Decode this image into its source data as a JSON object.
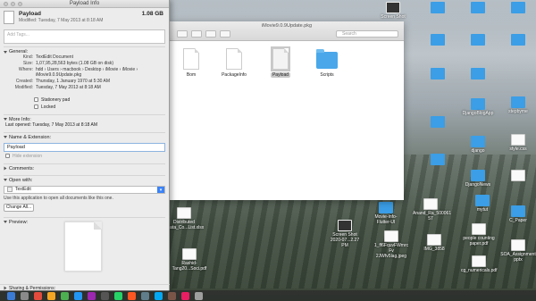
{
  "info_window": {
    "title": "Payload Info",
    "file_name": "Payload",
    "modified_header": "Modified: Tuesday, 7 May 2013 at 8:18 AM",
    "size": "1.08 GB",
    "tags_placeholder": "Add Tags...",
    "general": {
      "header": "General:",
      "rows": [
        {
          "key": "Kind:",
          "value": "TextEdit Document"
        },
        {
          "key": "Size:",
          "value": "1,07,95,28,563 bytes (1.08 GB on disk)"
        },
        {
          "key": "Where:",
          "value": "hdd › Users › macbook › Desktop › iMovie › iMovie › iMovie9.0.9Update.pkg"
        },
        {
          "key": "Created:",
          "value": "Thursday, 1 January 1970 at 5:30 AM"
        },
        {
          "key": "Modified:",
          "value": "Tuesday, 7 May 2013 at 8:18 AM"
        }
      ],
      "stationery": "Stationery pad",
      "locked": "Locked"
    },
    "more_info": {
      "header": "More Info:",
      "last_opened": "Last opened: Tuesday, 7 May 2013 at 8:18 AM"
    },
    "name_ext": {
      "header": "Name & Extension:",
      "value": "Payload",
      "hide_ext": "Hide extension"
    },
    "comments": {
      "header": "Comments:"
    },
    "open_with": {
      "header": "Open with:",
      "app": "TextEdit",
      "note": "Use this application to open all documents like this one.",
      "change_all": "Change All..."
    },
    "preview": {
      "header": "Preview:"
    },
    "sharing": {
      "header": "Sharing & Permissions:"
    }
  },
  "finder": {
    "title": "iMovie9.0.9Update.pkg",
    "search_placeholder": "Search",
    "items": [
      {
        "label": "Bom",
        "type": "doc"
      },
      {
        "label": "PackageInfo",
        "type": "doc"
      },
      {
        "label": "Payload",
        "type": "doc",
        "selected": true
      },
      {
        "label": "Scripts",
        "type": "folder"
      }
    ]
  },
  "desktop": [
    {
      "label": "Screen Shot"
    },
    {
      "label": "stepbyme"
    },
    {
      "label": "DjangoBlogApp"
    },
    {
      "label": "django"
    },
    {
      "label": "DjangoNews"
    },
    {
      "label": "style.css"
    },
    {
      "label": "mytut"
    },
    {
      "label": "C_Paper"
    },
    {
      "label": "Distributed ...ata_Co...List.xlsx"
    },
    {
      "label": "Screen Shot 2020-07...2.27 PM"
    },
    {
      "label": "Screen Shot 2020-07...2.27 PM"
    },
    {
      "label": "Movie-Info-Flutter-UI"
    },
    {
      "label": "1_ff6FquvFWmrc Fv 2JWfv5lag.jpeg"
    },
    {
      "label": "IMG_3858"
    },
    {
      "label": "people counting paper.pdf"
    },
    {
      "label": "SOA_Assignment pptx"
    },
    {
      "label": "Rashid-Tang20...Soci.pdf"
    },
    {
      "label": "cg_numericals.pdf"
    },
    {
      "label": "Anand_Ra_500061 57"
    }
  ]
}
